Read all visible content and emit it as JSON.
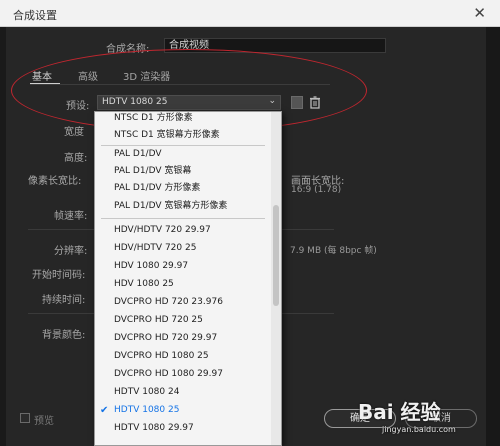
{
  "window": {
    "title": "合成设置",
    "close_glyph": "✕"
  },
  "composition": {
    "name_label": "合成名称:",
    "name_value": "合成视频"
  },
  "tabs": [
    {
      "label": "基本",
      "active": true
    },
    {
      "label": "高级",
      "active": false
    },
    {
      "label": "3D 渲染器",
      "active": false
    }
  ],
  "preset": {
    "label": "预设:",
    "value": "HDTV 1080 25"
  },
  "fields": {
    "width_label": "宽度",
    "height_label": "高度:",
    "pixel_aspect_label": "像素长宽比:",
    "frame_aspect_label": "画面长宽比:",
    "frame_aspect_value": "16:9 (1.78)",
    "frame_rate_label": "帧速率:",
    "resolution_label": "分辨率:",
    "resolution_value": "7.9 MB (每 8bpc 帧)",
    "start_timecode_label": "开始时间码:",
    "duration_label": "持续时间:",
    "bg_color_label": "背景颜色:"
  },
  "dropdown": {
    "group1": [
      "NTSC D1 方形像素",
      "NTSC D1 宽银幕方形像素"
    ],
    "group2": [
      "PAL D1/DV",
      "PAL D1/DV 宽银幕",
      "PAL D1/DV 方形像素",
      "PAL D1/DV 宽银幕方形像素"
    ],
    "group3": [
      "HDV/HDTV 720 29.97",
      "HDV/HDTV 720 25",
      "HDV 1080 29.97",
      "HDV 1080 25",
      "DVCPRO HD 720 23.976",
      "DVCPRO HD 720 25",
      "DVCPRO HD 720 29.97",
      "DVCPRO HD 1080 25",
      "DVCPRO HD 1080 29.97",
      "HDTV 1080 24",
      "HDTV 1080 25",
      "HDTV 1080 29.97"
    ],
    "selected": "HDTV 1080 25",
    "check_glyph": "✔"
  },
  "footer": {
    "preview_label": "预览",
    "ok_label": "确定",
    "cancel_label": "取消"
  },
  "watermark": {
    "brand": "Bai 经验",
    "url": "jingyan.baidu.com"
  },
  "colors": {
    "annotation_ellipse": "#c0262f",
    "selected_text": "#1473e6"
  }
}
